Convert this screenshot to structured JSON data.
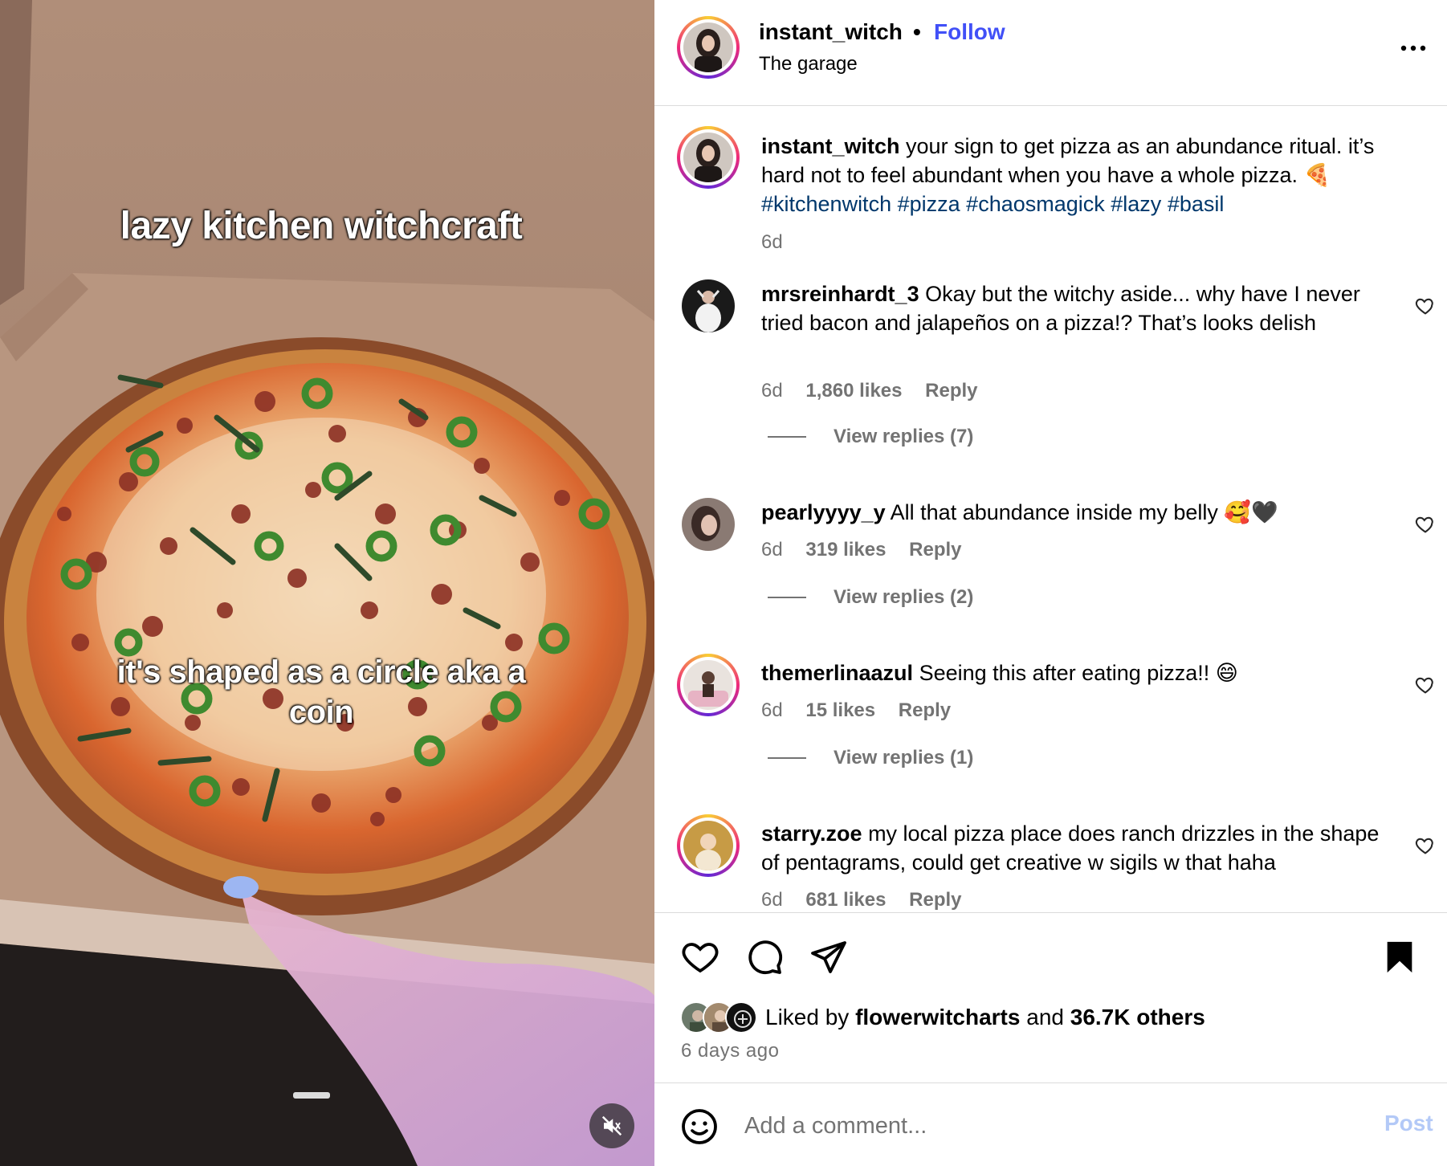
{
  "media": {
    "overlay_title": "lazy kitchen witchcraft",
    "overlay_sub": "it's shaped as a circle aka a coin",
    "mute_icon": "speaker-muted-icon"
  },
  "header": {
    "username": "instant_witch",
    "separator": "•",
    "follow_label": "Follow",
    "location": "The garage",
    "more_icon": "more-horizontal-icon"
  },
  "caption": {
    "username": "instant_witch",
    "text": " your sign to get pizza as an abundance ritual. it’s hard not to feel abundant when you have a whole pizza. 🍕",
    "hashtags": [
      "#kitchenwitch",
      "#pizza",
      "#chaosmagick",
      "#lazy",
      "#basil"
    ],
    "time": "6d"
  },
  "comments": [
    {
      "username": "mrsreinhardt_3",
      "text": " Okay but the witchy aside... why have I never tried bacon and jalapeños on a pizza!? That’s looks delish",
      "time": "6d",
      "likes": "1,860 likes",
      "reply": "Reply",
      "view_replies": "View replies (7)"
    },
    {
      "username": "pearlyyyy_y",
      "text": " All that abundance inside my belly 🥰🖤",
      "time": "6d",
      "likes": "319 likes",
      "reply": "Reply",
      "view_replies": "View replies (2)"
    },
    {
      "username": "themerlinaazul",
      "text": " Seeing this after eating pizza!! 😄",
      "time": "6d",
      "likes": "15 likes",
      "reply": "Reply",
      "view_replies": "View replies (1)"
    },
    {
      "username": "starry.zoe",
      "text": " my local pizza place does ranch drizzles in the shape of pentagrams, could get creative w sigils w that haha",
      "time": "6d",
      "likes": "681 likes",
      "reply": "Reply"
    }
  ],
  "actions": {
    "like_icon": "heart-icon",
    "comment_icon": "comment-bubble-icon",
    "share_icon": "paper-plane-icon",
    "save_icon": "bookmark-icon",
    "liked_by_prefix": "Liked by ",
    "liked_by_user": "flowerwitcharts",
    "liked_by_and": " and ",
    "liked_by_count": "36.7K others",
    "time_ago": "6 days ago"
  },
  "add_comment": {
    "placeholder": "Add a comment...",
    "post_label": "Post",
    "emoji_icon": "smiley-icon"
  },
  "colors": {
    "follow_blue": "#4150f7",
    "hashtag_blue": "#00376b",
    "muted_gray": "#737373",
    "post_disabled": "#b3c9f7"
  }
}
